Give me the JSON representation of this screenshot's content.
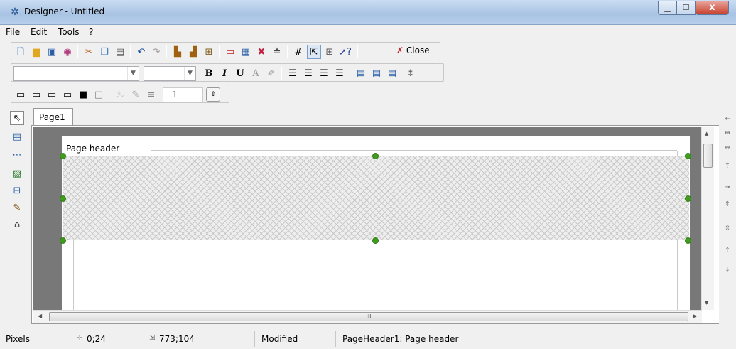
{
  "window": {
    "title": "Designer - Untitled",
    "close_glyph": "x"
  },
  "menu": [
    "File",
    "Edit",
    "Tools",
    "?"
  ],
  "toolbar1": {
    "close_label": "Close"
  },
  "toolbar3": {
    "line_width": "1"
  },
  "tabs": [
    {
      "label": "Page1"
    }
  ],
  "band": {
    "label": "Page header"
  },
  "scroll": {
    "hscroll_grip": "III"
  },
  "status": {
    "units": "Pixels",
    "position": "0;24",
    "size": "773;104",
    "state": "Modified",
    "selection": "PageHeader1: Page header"
  },
  "colors": {
    "selection_handle": "#3f9c1c",
    "workspace": "#787878",
    "titlebar": "#b7cfeb"
  },
  "icons": [
    "new-icon",
    "open-icon",
    "save-icon",
    "preview-icon",
    "cut-icon",
    "copy-icon",
    "paste-icon",
    "undo-icon",
    "redo-icon",
    "bring-front-icon",
    "send-back-icon",
    "group-icon",
    "page-setup-icon",
    "insert-icon",
    "delete-icon",
    "report-icon",
    "grid-icon",
    "snap-icon",
    "align-icon",
    "help-icon",
    "bold-icon",
    "italic-icon",
    "underline-icon",
    "font-color-icon",
    "highlight-icon",
    "align-left-icon",
    "align-center-icon",
    "align-right-icon",
    "justify-icon"
  ]
}
